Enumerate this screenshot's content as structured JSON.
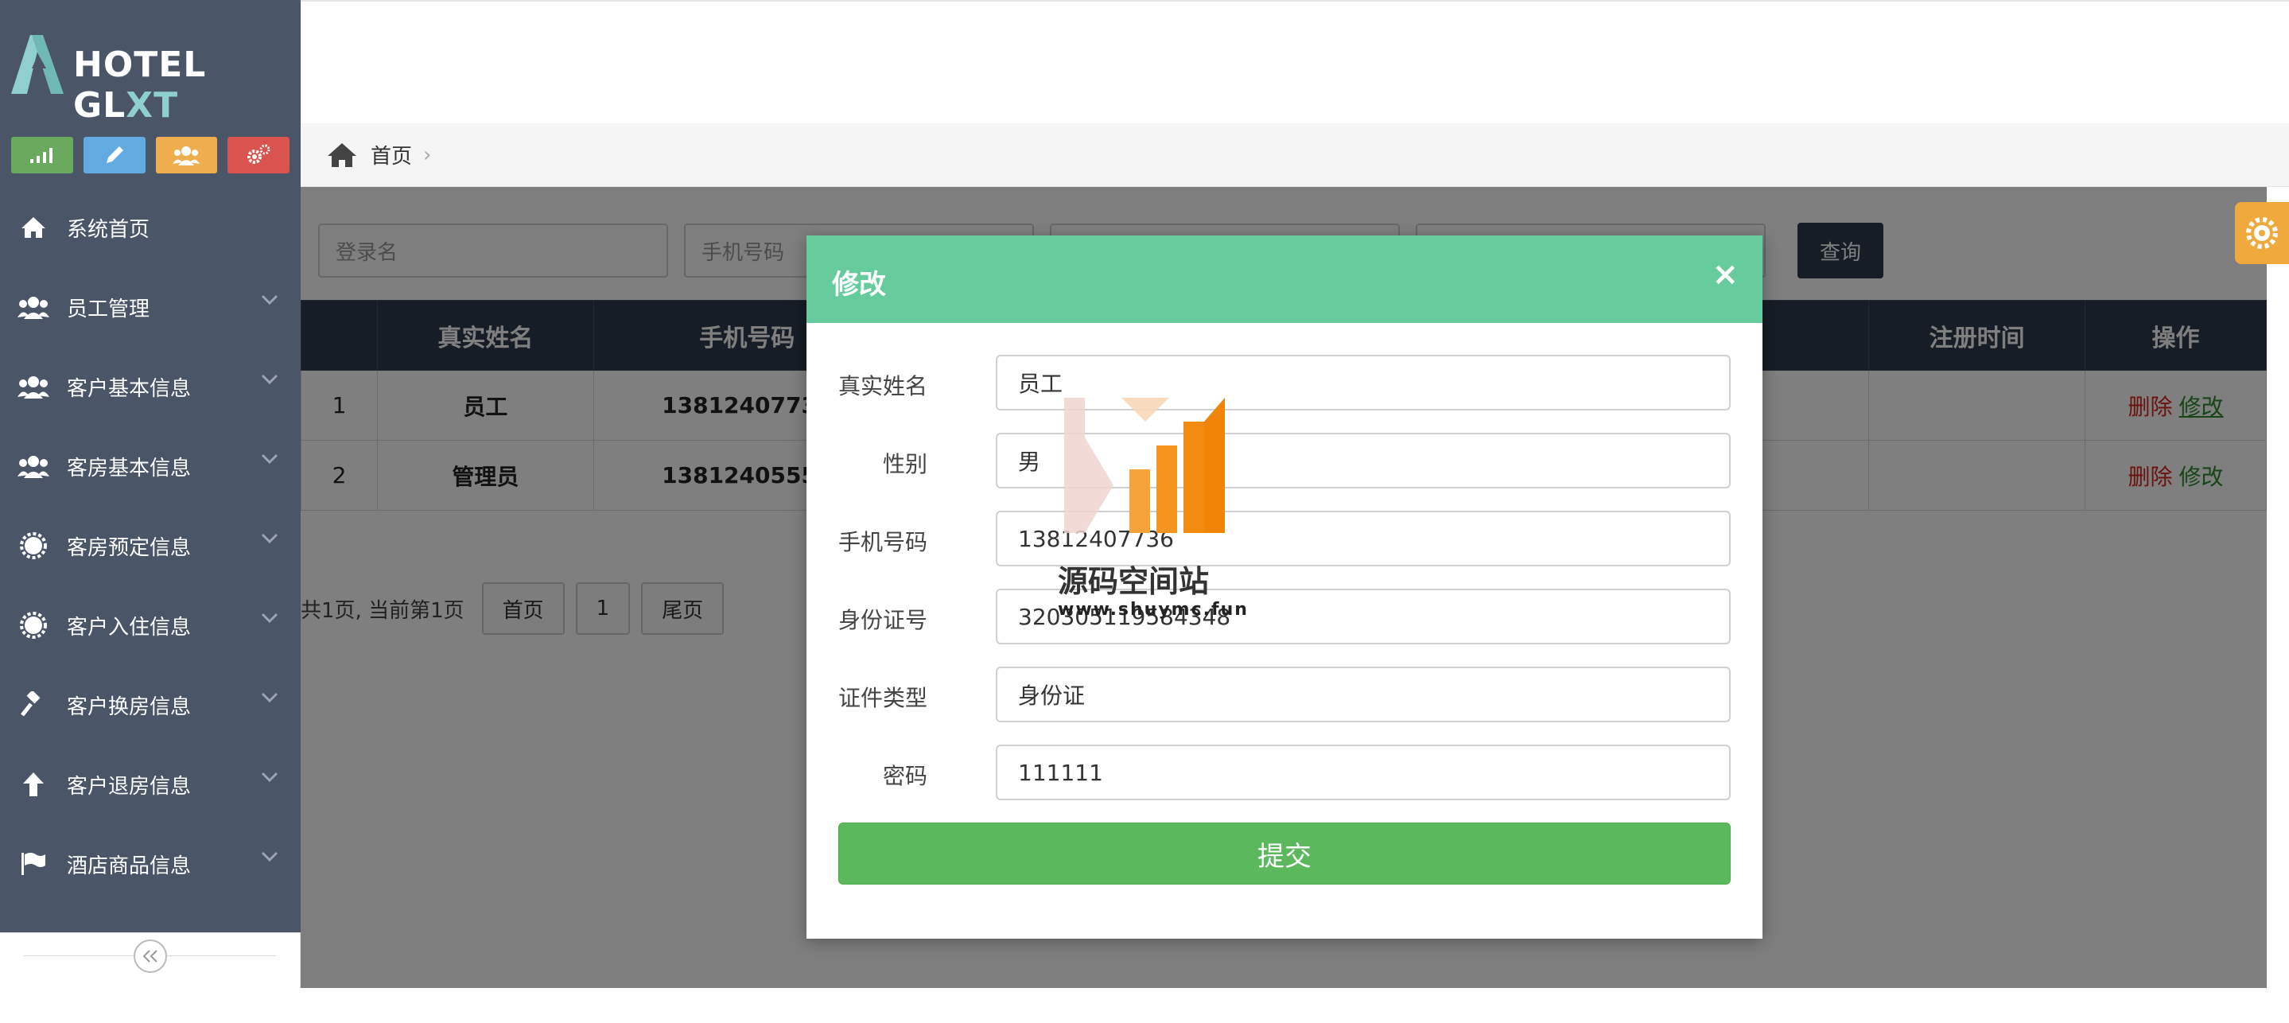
{
  "brand": {
    "name_main": "HOTEL GL",
    "name_accent": "XT"
  },
  "shortcuts": [
    {
      "icon": "signal-icon",
      "color": "#6aaa5e"
    },
    {
      "icon": "pencil-icon",
      "color": "#62abe0"
    },
    {
      "icon": "users-icon",
      "color": "#f0ad4e"
    },
    {
      "icon": "cogs-icon",
      "color": "#d9534f"
    }
  ],
  "menu": [
    {
      "label": "系统首页",
      "icon": "home-icon"
    },
    {
      "label": "员工管理",
      "icon": "users-icon"
    },
    {
      "label": "客户基本信息",
      "icon": "users-icon"
    },
    {
      "label": "客房基本信息",
      "icon": "users-icon"
    },
    {
      "label": "客房预定信息",
      "icon": "gear-icon"
    },
    {
      "label": "客户入住信息",
      "icon": "gear-icon"
    },
    {
      "label": "客户换房信息",
      "icon": "gavel-icon"
    },
    {
      "label": "客户退房信息",
      "icon": "arrow-up-icon"
    },
    {
      "label": "酒店商品信息",
      "icon": "flag-icon"
    }
  ],
  "breadcrumb": {
    "home": "首页",
    "separator": "›"
  },
  "search": {
    "login_placeholder": "登录名",
    "phone_placeholder": "手机号码",
    "button_label": "查询"
  },
  "table": {
    "headers": [
      "",
      "真实姓名",
      "手机号码",
      "注册时间",
      "操作"
    ],
    "rows": [
      {
        "index": "1",
        "name": "员工",
        "phone": "13812407736",
        "delete": "删除",
        "edit": "修改"
      },
      {
        "index": "2",
        "name": "管理员",
        "phone": "13812405555",
        "delete": "删除",
        "edit": "修改"
      }
    ]
  },
  "pager": {
    "summary": "共1页, 当前第1页",
    "first": "首页",
    "page": "1",
    "last": "尾页"
  },
  "modal": {
    "title": "修改",
    "close": "×",
    "fields": [
      {
        "label": "真实姓名",
        "value": "员工"
      },
      {
        "label": "性别",
        "value": "男"
      },
      {
        "label": "手机号码",
        "value": "13812407736"
      },
      {
        "label": "身份证号",
        "value": "320305119584348"
      },
      {
        "label": "证件类型",
        "value": "身份证"
      },
      {
        "label": "密码",
        "value": "111111"
      }
    ],
    "submit": "提交"
  },
  "watermark": {
    "text": "源码空间站",
    "url": "www.shuymc.fun"
  }
}
